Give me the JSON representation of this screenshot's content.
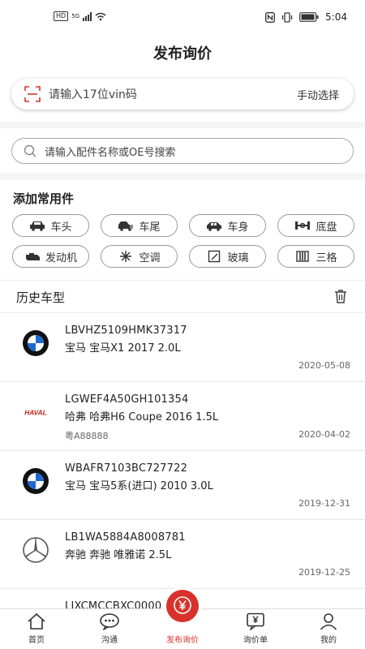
{
  "status": {
    "chip": "HD",
    "net": "5G",
    "time": "5:04"
  },
  "header": {
    "title": "发布询价"
  },
  "vin": {
    "placeholder": "请输入17位vin码",
    "manual": "手动选择"
  },
  "search": {
    "placeholder": "请输入配件名称或OE号搜索"
  },
  "parts": {
    "title": "添加常用件",
    "items": [
      {
        "label": "车头",
        "icon": "car-front-icon"
      },
      {
        "label": "车尾",
        "icon": "car-rear-icon"
      },
      {
        "label": "车身",
        "icon": "car-body-icon"
      },
      {
        "label": "底盘",
        "icon": "chassis-icon"
      },
      {
        "label": "发动机",
        "icon": "engine-icon"
      },
      {
        "label": "空调",
        "icon": "snowflake-icon"
      },
      {
        "label": "玻璃",
        "icon": "glass-icon"
      },
      {
        "label": "三格",
        "icon": "grille-icon"
      }
    ]
  },
  "history": {
    "title": "历史车型",
    "rows": [
      {
        "brand": "bmw",
        "vin": "LBVHZ5109HMK37317",
        "model": "宝马 宝马X1 2017 2.0L",
        "plate": "",
        "date": "2020-05-08"
      },
      {
        "brand": "haval",
        "vin": "LGWEF4A50GH101354",
        "model": "哈弗 哈弗H6 Coupe 2016 1.5L",
        "plate": "粤A88888",
        "date": "2020-04-02"
      },
      {
        "brand": "bmw",
        "vin": "WBAFR7103BC727722",
        "model": "宝马 宝马5系(进口) 2010 3.0L",
        "plate": "",
        "date": "2019-12-31"
      },
      {
        "brand": "benz",
        "vin": "LB1WA5884A8008781",
        "model": "奔驰 奔驰 唯雅诺 2.5L",
        "plate": "",
        "date": "2019-12-25"
      },
      {
        "brand": "",
        "vin": "LJXCMCCBXC0000",
        "model": "",
        "plate": "",
        "date": ""
      }
    ]
  },
  "brand_text": {
    "haval": "HAVAL"
  },
  "tabs": [
    {
      "label": "首页",
      "icon": "home-icon"
    },
    {
      "label": "沟通",
      "icon": "chat-icon"
    },
    {
      "label": "发布询价",
      "icon": "yen-circle-icon"
    },
    {
      "label": "询价单",
      "icon": "inquiry-list-icon"
    },
    {
      "label": "我的",
      "icon": "profile-icon"
    }
  ],
  "colors": {
    "accent": "#d9322c",
    "bmw_blue": "#1c69d4"
  }
}
